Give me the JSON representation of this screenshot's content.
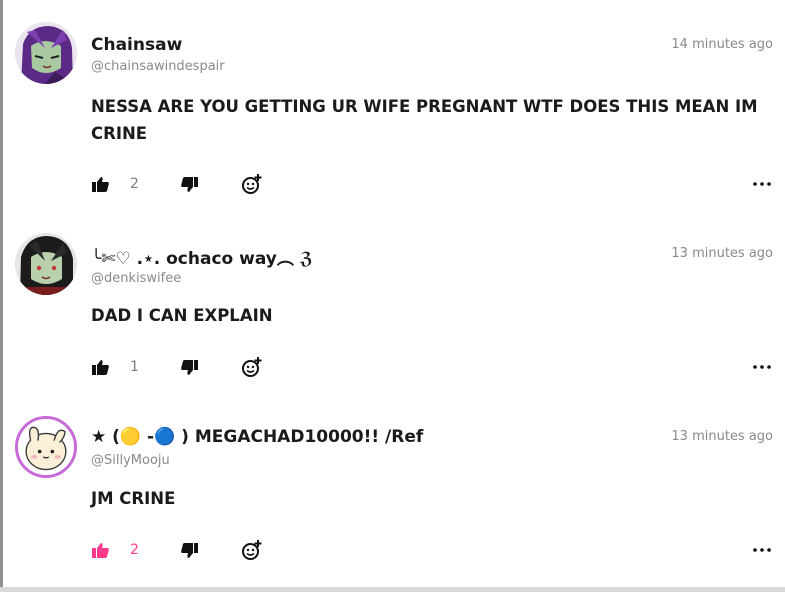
{
  "comments": [
    {
      "author": "Chainsaw",
      "handle": "@chainsawindespair",
      "time": "14 minutes ago",
      "text": "NESSA ARE YOU GETTING UR WIFE PREGNANT WTF DOES THIS MEAN IM CRINE",
      "likes": "2",
      "liked": false,
      "avatar_icon": "anime-avatar-purple-hair",
      "like_icon": "thumbs-up-icon",
      "dislike_icon": "thumbs-down-icon",
      "react_icon": "add-reaction-icon",
      "more_icon": "more-options-icon"
    },
    {
      "author": "╰✄♡ .⋆. ochaco way︵ ℨ",
      "handle": "@denkiswifee",
      "time": "13 minutes ago",
      "text": "DAD I CAN EXPLAIN",
      "likes": "1",
      "liked": false,
      "avatar_icon": "anime-avatar-dark-hair",
      "like_icon": "thumbs-up-icon",
      "dislike_icon": "thumbs-down-icon",
      "react_icon": "add-reaction-icon",
      "more_icon": "more-options-icon"
    },
    {
      "author": "★ (🟡 -🔵 ) MEGACHAD10000!! /Ref",
      "handle": "@SillyMooju",
      "time": "13 minutes ago",
      "text": "JM CRINE",
      "likes": "2",
      "liked": true,
      "avatar_icon": "cartoon-avatar-bunny",
      "like_icon": "thumbs-up-icon",
      "dislike_icon": "thumbs-down-icon",
      "react_icon": "add-reaction-icon",
      "more_icon": "more-options-icon"
    }
  ],
  "colors": {
    "liked": "#ff3a8c",
    "muted": "#8a8a8a",
    "avatar_ring": "#c76ad8"
  }
}
